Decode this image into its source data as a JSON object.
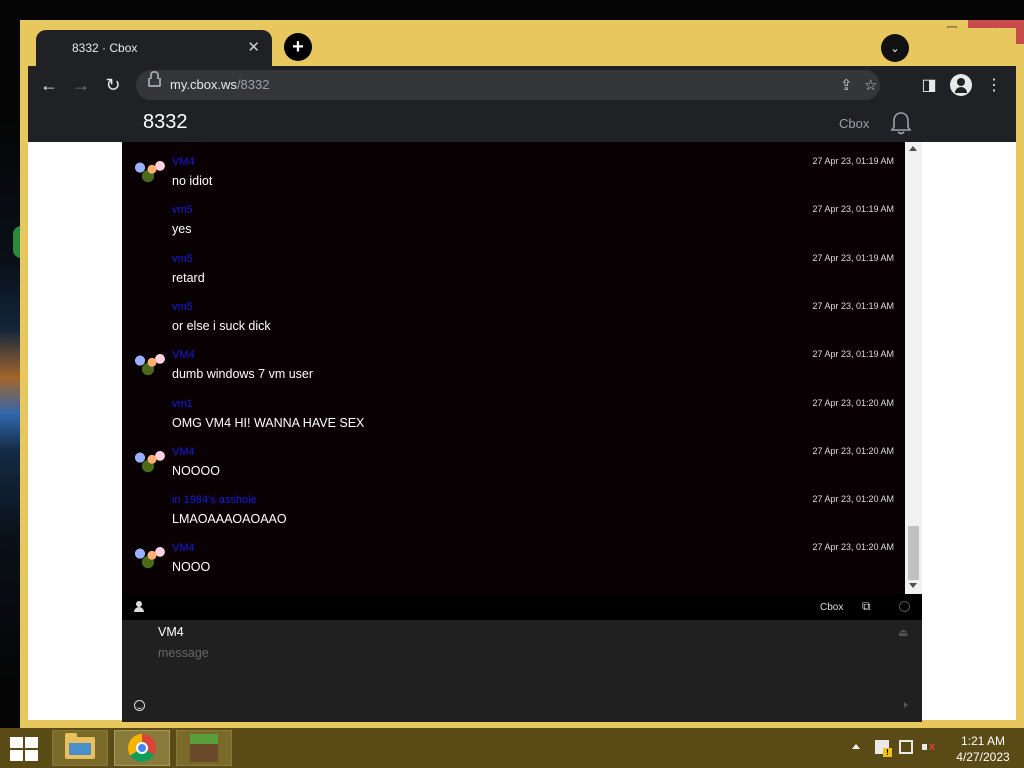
{
  "window": {
    "controls": {
      "minimize": "–",
      "maximize": "☐",
      "close": "✕"
    }
  },
  "browser": {
    "tab_title": "8332 · Cbox",
    "tab_close": "✕",
    "new_tab": "+",
    "tab_search": "⌄",
    "url_domain": "my.cbox.ws",
    "url_path": "/8332",
    "nav": {
      "back": "←",
      "forward": "→",
      "reload": "↻"
    },
    "omnibox_icons": {
      "share": "⇪",
      "bookmark": "☆"
    },
    "toolbar_icons": {
      "side_panel": "◨",
      "menu": "⋮"
    }
  },
  "site": {
    "title": "8332",
    "brand": "Cbox"
  },
  "messages": [
    {
      "name": "VM4",
      "time": "27 Apr 23, 01:19 AM",
      "text": "no idiot",
      "avatar": true
    },
    {
      "name": "vm5",
      "time": "27 Apr 23, 01:19 AM",
      "text": "yes",
      "avatar": false
    },
    {
      "name": "vm5",
      "time": "27 Apr 23, 01:19 AM",
      "text": "retard",
      "avatar": false
    },
    {
      "name": "vm5",
      "time": "27 Apr 23, 01:19 AM",
      "text": "or else i suck dick",
      "avatar": false
    },
    {
      "name": "VM4",
      "time": "27 Apr 23, 01:19 AM",
      "text": "dumb windows 7 vm user",
      "avatar": true
    },
    {
      "name": "vm1",
      "time": "27 Apr 23, 01:20 AM",
      "text": "OMG VM4 HI! WANNA HAVE SEX",
      "avatar": false
    },
    {
      "name": "VM4",
      "time": "27 Apr 23, 01:20 AM",
      "text": "NOOOO",
      "avatar": true
    },
    {
      "name": "in 1984's asshole",
      "time": "27 Apr 23, 01:20 AM",
      "text": "LMAOAAAOAOAAO",
      "avatar": false
    },
    {
      "name": "VM4",
      "time": "27 Apr 23, 01:20 AM",
      "text": "NOOO",
      "avatar": true
    }
  ],
  "cbox_bar": {
    "label": "Cbox",
    "popout_icon": "⧉"
  },
  "compose": {
    "name_value": "VM4",
    "message_placeholder": "message",
    "logout_icon": "⏏"
  },
  "taskbar": {
    "clock_time": "1:21 AM",
    "clock_date": "4/27/2023"
  },
  "colors": {
    "window_frame": "#e8c85e",
    "chat_background": "#080002",
    "username_color": "#1a1adc",
    "taskbar": "#5a4a16"
  }
}
